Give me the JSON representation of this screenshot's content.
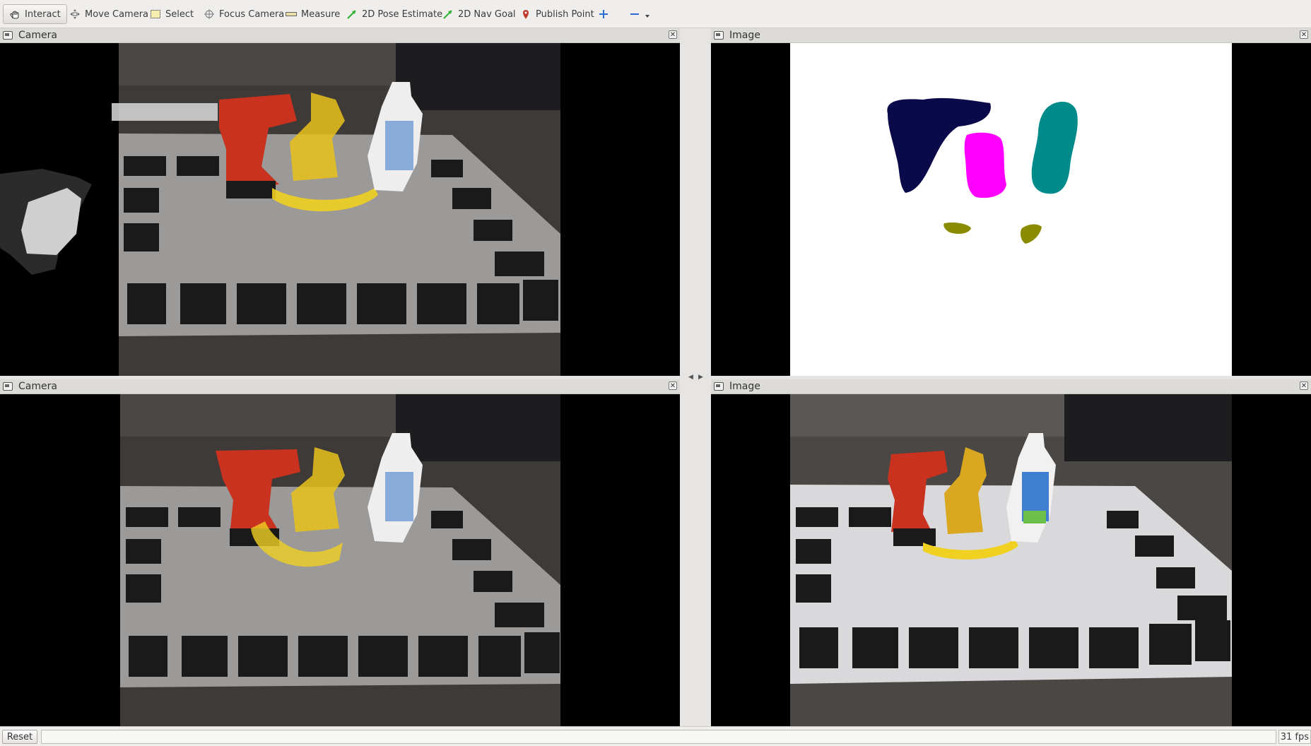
{
  "toolbar": {
    "interact": "Interact",
    "move_camera": "Move Camera",
    "select": "Select",
    "focus_camera": "Focus Camera",
    "measure": "Measure",
    "pose_estimate": "2D Pose Estimate",
    "nav_goal": "2D Nav Goal",
    "publish_point": "Publish Point"
  },
  "panes": {
    "top_left": {
      "title": "Camera"
    },
    "top_right": {
      "title": "Image"
    },
    "bottom_left": {
      "title": "Camera"
    },
    "bottom_right": {
      "title": "Image"
    }
  },
  "statusbar": {
    "reset": "Reset",
    "fps": "31 fps"
  },
  "colors": {
    "mask_navy": "#0a0a4a",
    "mask_magenta": "#ff00ff",
    "mask_teal": "#008b8b",
    "mask_olive": "#8b8b00",
    "drill_red": "#c8321e",
    "mustard_yellow": "#e8c21a",
    "banana_yellow": "#f0d020"
  }
}
